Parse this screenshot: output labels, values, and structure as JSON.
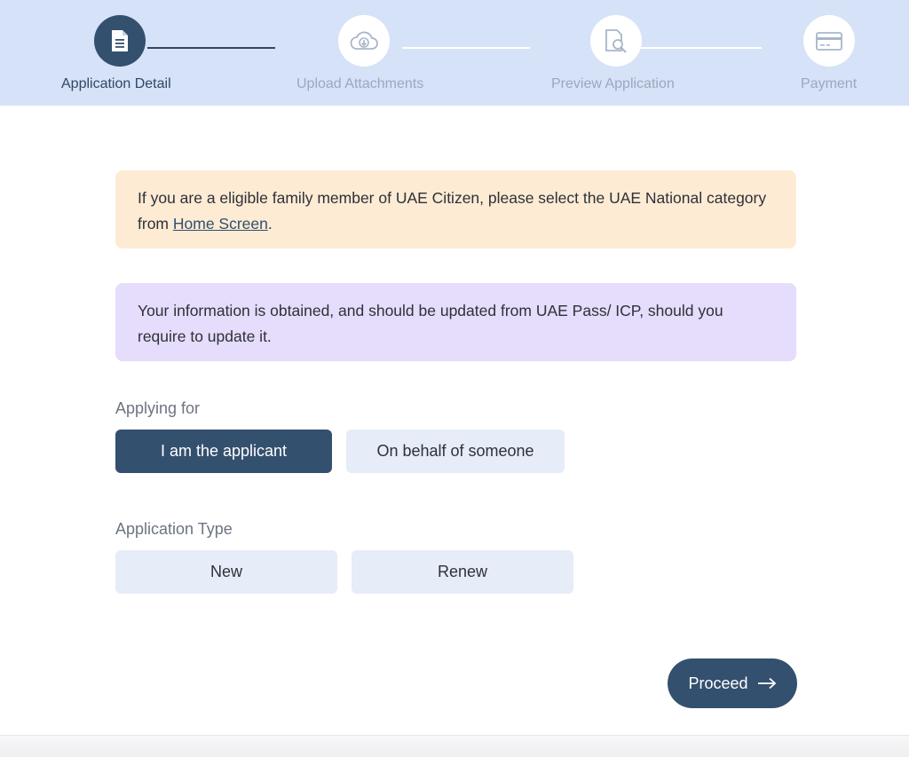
{
  "stepper": {
    "steps": [
      {
        "label": "Application Detail",
        "icon": "document-icon",
        "active": true
      },
      {
        "label": "Upload Attachments",
        "icon": "cloud-upload-icon",
        "active": false
      },
      {
        "label": "Preview Application",
        "icon": "document-search-icon",
        "active": false
      },
      {
        "label": "Payment",
        "icon": "credit-card-icon",
        "active": false
      }
    ]
  },
  "banners": {
    "family_notice_prefix": "If you are a eligible family member of UAE Citizen, please select the UAE National category from",
    "family_notice_link": "Home Screen",
    "family_notice_suffix": ".",
    "info_notice": "Your information is obtained, and should be updated from UAE Pass/ ICP, should you require to update it."
  },
  "applying_for": {
    "label": "Applying for",
    "options": [
      "I am the applicant",
      "On behalf of someone"
    ],
    "selected": "I am the applicant"
  },
  "application_type": {
    "label": "Application Type",
    "options": [
      "New",
      "Renew"
    ]
  },
  "actions": {
    "proceed_label": "Proceed",
    "proceed_icon": "arrow-right-icon"
  },
  "colors": {
    "primary": "#34506f",
    "stepper_bg": "#d6e2f7",
    "warning_bg": "#feebd4",
    "info_bg": "#e6dcfb",
    "option_bg": "#e6ecf8"
  }
}
